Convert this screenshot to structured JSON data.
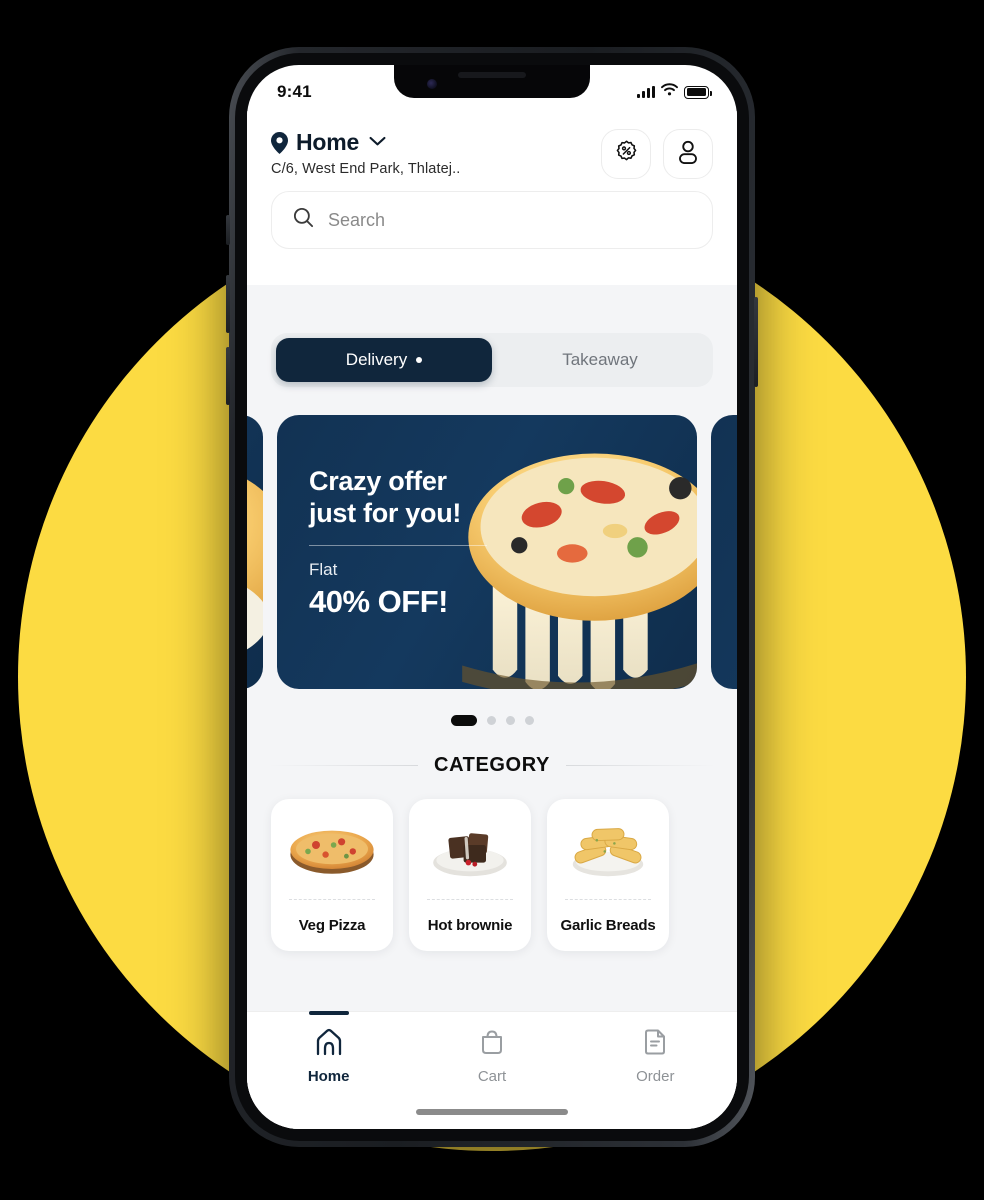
{
  "status_bar": {
    "time": "9:41",
    "signal_icon": "cellular-bars-icon",
    "wifi_icon": "wifi-icon",
    "battery_icon": "battery-icon"
  },
  "header": {
    "pin_icon": "location-pin-icon",
    "location_title": "Home",
    "chevron_icon": "chevron-down-icon",
    "address": "C/6, West End Park, Thlatej..",
    "actions": [
      {
        "name": "offers-button",
        "icon": "discount-badge-icon"
      },
      {
        "name": "profile-button",
        "icon": "user-icon"
      }
    ]
  },
  "search": {
    "icon": "search-icon",
    "placeholder": "Search",
    "value": ""
  },
  "mode_tabs": {
    "items": [
      {
        "label": "Delivery",
        "active": true,
        "has_dot": true
      },
      {
        "label": "Takeaway",
        "active": false,
        "has_dot": false
      }
    ]
  },
  "banner": {
    "headline_line1": "Crazy offer",
    "headline_line2": "just for you!",
    "flat_label": "Flat",
    "discount": "40% OFF!",
    "bg_color": "#123253"
  },
  "carousel": {
    "total_dots": 4,
    "active_index": 0
  },
  "category": {
    "title": "CATEGORY",
    "items": [
      {
        "label": "Veg Pizza",
        "image": "veg-pizza-image"
      },
      {
        "label": "Hot brownie",
        "image": "hot-brownie-image"
      },
      {
        "label": "Garlic Breads",
        "image": "garlic-breads-image"
      }
    ]
  },
  "bottom_nav": {
    "items": [
      {
        "label": "Home",
        "icon": "home-icon",
        "active": true
      },
      {
        "label": "Cart",
        "icon": "shopping-bag-icon",
        "active": false
      },
      {
        "label": "Order",
        "icon": "document-list-icon",
        "active": false
      }
    ]
  },
  "theme": {
    "backdrop": "#FCDB42",
    "page_background": "#000000",
    "accent_dark": "#10263c",
    "app_surface": "#f4f5f7"
  }
}
